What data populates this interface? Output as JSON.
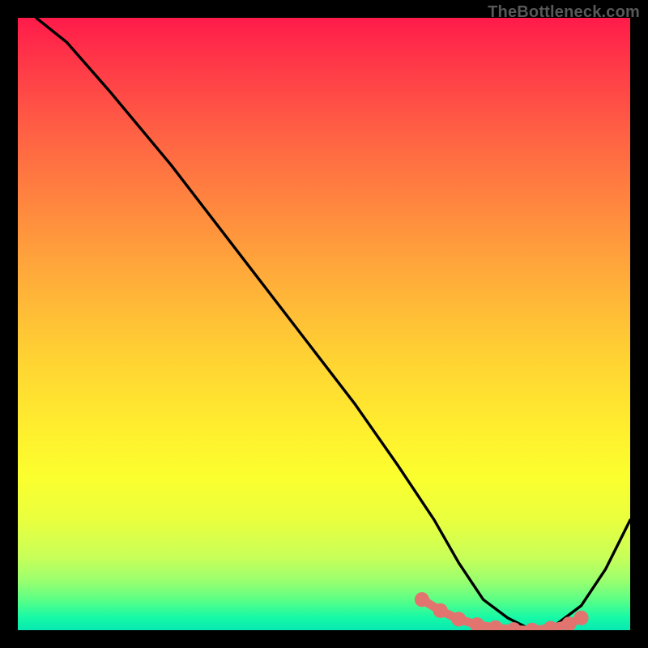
{
  "watermark": "TheBottleneck.com",
  "chart_data": {
    "type": "line",
    "title": "",
    "xlabel": "",
    "ylabel": "",
    "xlim": [
      0,
      100
    ],
    "ylim": [
      0,
      100
    ],
    "grid": false,
    "series": [
      {
        "name": "curve",
        "color": "#000000",
        "x": [
          3,
          8,
          15,
          25,
          35,
          45,
          55,
          62,
          68,
          72,
          76,
          80,
          84,
          88,
          92,
          96,
          100
        ],
        "values": [
          100,
          96,
          88,
          76,
          63,
          50,
          37,
          27,
          18,
          11,
          5,
          2,
          0,
          1,
          4,
          10,
          18
        ]
      }
    ],
    "marker_band": {
      "name": "optimal-zone",
      "color": "#e2746f",
      "x": [
        66,
        69,
        72,
        75,
        78,
        81,
        84,
        87,
        90,
        92
      ],
      "values": [
        5.0,
        3.2,
        1.8,
        0.9,
        0.4,
        0.1,
        0.0,
        0.3,
        1.0,
        2.0
      ]
    },
    "background_gradient": {
      "orientation": "vertical",
      "stops": [
        {
          "pos": 0.0,
          "color": "#ff1b4a"
        },
        {
          "pos": 0.3,
          "color": "#ff853f"
        },
        {
          "pos": 0.55,
          "color": "#ffd133"
        },
        {
          "pos": 0.8,
          "color": "#e9ff3e"
        },
        {
          "pos": 0.95,
          "color": "#5bff86"
        },
        {
          "pos": 1.0,
          "color": "#08e8b2"
        }
      ]
    }
  }
}
